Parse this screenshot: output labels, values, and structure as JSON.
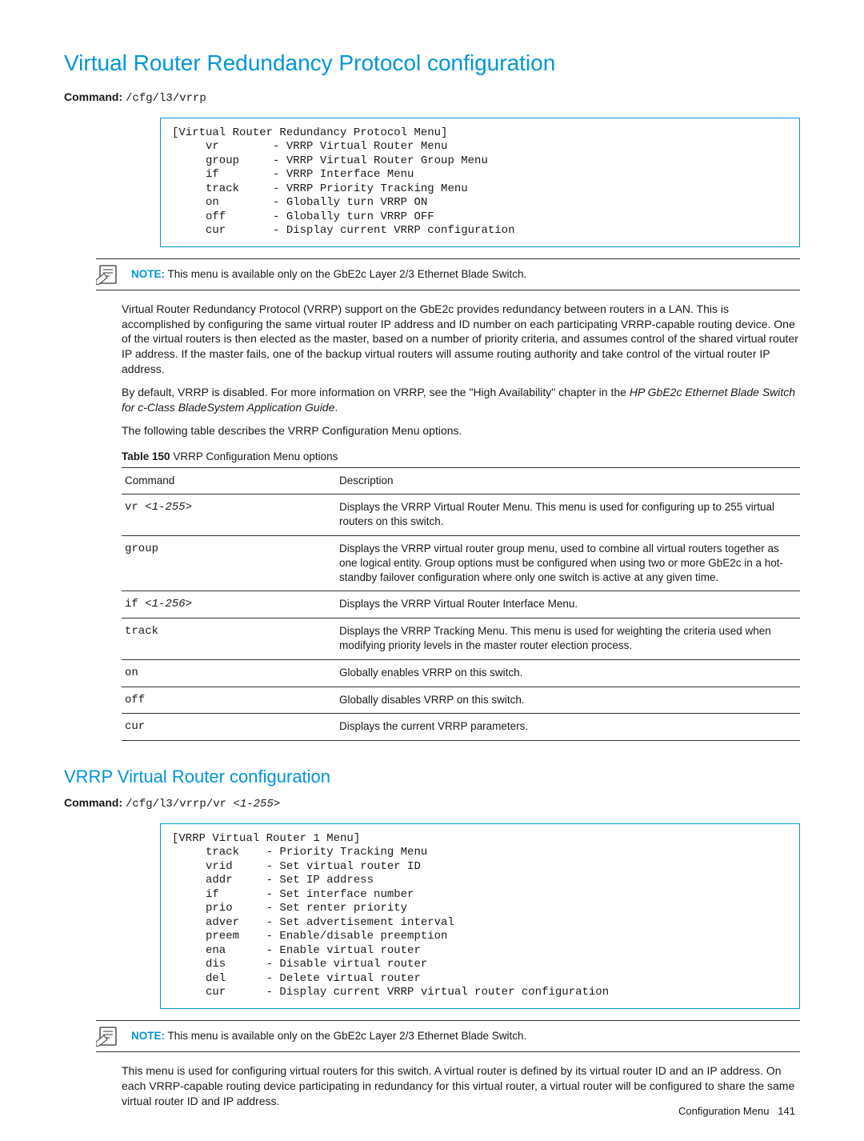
{
  "h1": "Virtual Router Redundancy Protocol configuration",
  "cmd1": {
    "label": "Command:",
    "path": "/cfg/l3/vrrp"
  },
  "term1": "[Virtual Router Redundancy Protocol Menu]\n     vr        - VRRP Virtual Router Menu\n     group     - VRRP Virtual Router Group Menu\n     if        - VRRP Interface Menu\n     track     - VRRP Priority Tracking Menu\n     on        - Globally turn VRRP ON\n     off       - Globally turn VRRP OFF\n     cur       - Display current VRRP configuration",
  "note1": {
    "label": "NOTE:",
    "text": "This menu is available only on the GbE2c Layer 2/3 Ethernet Blade Switch."
  },
  "para1": "Virtual Router Redundancy Protocol (VRRP) support on the GbE2c provides redundancy between routers in a LAN. This is accomplished by configuring the same virtual router IP address and ID number on each participating VRRP-capable routing device. One of the virtual routers is then elected as the master, based on a number of priority criteria, and assumes control of the shared virtual router IP address. If the master fails, one of the backup virtual routers will assume routing authority and take control of the virtual router IP address.",
  "para2a": "By default, VRRP is disabled. For more information on VRRP, see the \"High Availability\" chapter in the ",
  "para2b": "HP GbE2c Ethernet Blade Switch for c-Class BladeSystem Application Guide",
  "para2c": ".",
  "para3": "The following table describes the VRRP Configuration Menu options.",
  "tcap": {
    "num": "Table 150",
    "text": "VRRP Configuration Menu options"
  },
  "thead": {
    "c1": "Command",
    "c2": "Description"
  },
  "rows": [
    {
      "c1a": "vr ",
      "c1b": "<1-255>",
      "c2": "Displays the VRRP Virtual Router Menu. This menu is used for configuring up to 255 virtual routers on this switch."
    },
    {
      "c1a": "group",
      "c1b": "",
      "c2": "Displays the VRRP virtual router group menu, used to combine all virtual routers together as one logical entity. Group options must be configured when using two or more GbE2c in a hot-standby failover configuration where only one switch is active at any given time."
    },
    {
      "c1a": "if ",
      "c1b": "<1-256>",
      "c2": "Displays the VRRP Virtual Router Interface Menu."
    },
    {
      "c1a": "track",
      "c1b": "",
      "c2": "Displays the VRRP Tracking Menu. This menu is used for weighting the criteria used when modifying priority levels in the master router election process."
    },
    {
      "c1a": "on",
      "c1b": "",
      "c2": "Globally enables VRRP on this switch."
    },
    {
      "c1a": "off",
      "c1b": "",
      "c2": "Globally disables VRRP on this switch."
    },
    {
      "c1a": "cur",
      "c1b": "",
      "c2": "Displays the current VRRP parameters."
    }
  ],
  "h2": "VRRP Virtual Router configuration",
  "cmd2": {
    "label": "Command:",
    "path": "/cfg/l3/vrrp/vr ",
    "arg": "<1-255>"
  },
  "term2": "[VRRP Virtual Router 1 Menu]\n     track    - Priority Tracking Menu\n     vrid     - Set virtual router ID\n     addr     - Set IP address\n     if       - Set interface number\n     prio     - Set renter priority\n     adver    - Set advertisement interval\n     preem    - Enable/disable preemption\n     ena      - Enable virtual router\n     dis      - Disable virtual router\n     del      - Delete virtual router\n     cur      - Display current VRRP virtual router configuration",
  "note2": {
    "label": "NOTE:",
    "text": "This menu is available only on the GbE2c Layer 2/3 Ethernet Blade Switch."
  },
  "para4": "This menu is used for configuring virtual routers for this switch. A virtual router is defined by its virtual router ID and an IP address. On each VRRP-capable routing device participating in redundancy for this virtual router, a virtual router will be configured to share the same virtual router ID and IP address.",
  "footer": {
    "section": "Configuration Menu",
    "page": "141"
  }
}
